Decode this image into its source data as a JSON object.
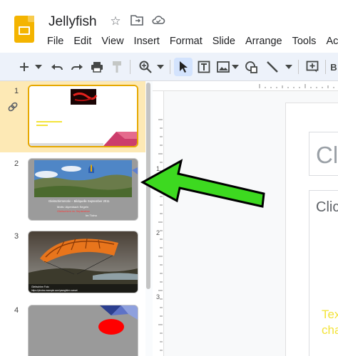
{
  "doc": {
    "title": "Jellyfish"
  },
  "menu": [
    "File",
    "Edit",
    "View",
    "Insert",
    "Format",
    "Slide",
    "Arrange",
    "Tools",
    "Ac"
  ],
  "toolbar": {
    "bg_label": "B"
  },
  "slides": [
    {
      "number": "1",
      "selected": true
    },
    {
      "number": "2",
      "selected": false,
      "caption": "Gleitschirmmotiv – Bildquelle September 2011",
      "line2": "Motiv: Alpenbach Segeln",
      "line3": "Gleitschirm im September",
      "line4": "Im Ticino"
    },
    {
      "number": "3",
      "selected": false,
      "caption": "Gleitschirm Foto",
      "credit": "https://photos.example.com/paraglider-sunset"
    },
    {
      "number": "4",
      "selected": false
    }
  ],
  "ruler": {
    "marks": [
      "1",
      "2",
      "3"
    ]
  },
  "canvas": {
    "title_placeholder": "Cli",
    "body_placeholder": "Clic",
    "yellow_text_line1": "Tex",
    "yellow_text_line2": "cha"
  },
  "colors": {
    "accent": "#fde9b5",
    "arrow": "#3dd920",
    "toolbar": "#edf2fa",
    "logo": "#f4b400"
  }
}
